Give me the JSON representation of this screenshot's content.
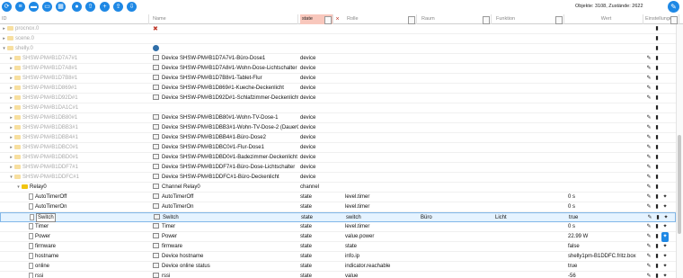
{
  "toolbar": {
    "buttons": [
      "refresh-icon",
      "list-icon",
      "folder-icon",
      "folder-open-icon",
      "table-icon",
      "user-icon",
      "upload-icon",
      "add-icon",
      "import-icon",
      "export-icon"
    ],
    "object_count": "Objekte: 3108, Zustände: 2622"
  },
  "header": {
    "id": "ID",
    "name": "Name",
    "state_filter": "state",
    "role": "Rolle",
    "room": "Raum",
    "function": "Funktion",
    "value": "Wert",
    "settings": "Einstellungen"
  },
  "colors": {
    "accent": "#1e88e5",
    "filter_active": "#f8c7bc",
    "folder": "#f1c40f",
    "selected_row": "#e5f3ff"
  },
  "rows": [
    {
      "id": "procnox.0",
      "name": "",
      "type": "",
      "role": "",
      "room": "",
      "func": "",
      "value": "",
      "icon": "procnox"
    },
    {
      "id": "scene.0",
      "name": "",
      "type": "",
      "role": "",
      "room": "",
      "func": "",
      "value": "",
      "icon": ""
    },
    {
      "id": "shelly.0",
      "name": "",
      "type": "",
      "role": "",
      "room": "",
      "func": "",
      "value": "",
      "icon": "shelly"
    },
    {
      "id": "SHSW-PM#B1D7A7#1",
      "name": "Device SHSW-PM#B1D7A7#1-Büro-Dose1",
      "type": "device",
      "role": "",
      "room": "",
      "func": "",
      "value": ""
    },
    {
      "id": "SHSW-PM#B1D7A8#1",
      "name": "Device SHSW-PM#B1D7A8#1-Wohn-Dose-Lichtschalter",
      "type": "device",
      "role": "",
      "room": "",
      "func": "",
      "value": ""
    },
    {
      "id": "SHSW-PM#B1D7B8#1",
      "name": "Device SHSW-PM#B1D7B8#1-Tablet-Flur",
      "type": "device",
      "role": "",
      "room": "",
      "func": "",
      "value": ""
    },
    {
      "id": "SHSW-PM#B1D869#1",
      "name": "Device SHSW-PM#B1D869#1-Kueche-Deckenlicht",
      "type": "device",
      "role": "",
      "room": "",
      "func": "",
      "value": ""
    },
    {
      "id": "SHSW-PM#B1D92D#1",
      "name": "Device SHSW-PM#B1D92D#1-Schlafzimmer-Deckenlicht",
      "type": "device",
      "role": "",
      "room": "",
      "func": "",
      "value": ""
    },
    {
      "id": "SHSW-PM#B1DA1C#1",
      "name": "",
      "type": "",
      "role": "",
      "room": "",
      "func": "",
      "value": ""
    },
    {
      "id": "SHSW-PM#B1DB80#1",
      "name": "Device SHSW-PM#B1DB80#1-Wohn-TV-Dose-1",
      "type": "device",
      "role": "",
      "room": "",
      "func": "",
      "value": ""
    },
    {
      "id": "SHSW-PM#B1DBB3#1",
      "name": "Device SHSW-PM#B1DBB3#1-Wohn-TV-Dose-2 (DauerON)",
      "type": "device",
      "role": "",
      "room": "",
      "func": "",
      "value": ""
    },
    {
      "id": "SHSW-PM#B1DBB4#1",
      "name": "Device SHSW-PM#B1DBB4#1-Büro-Dose2",
      "type": "device",
      "role": "",
      "room": "",
      "func": "",
      "value": ""
    },
    {
      "id": "SHSW-PM#B1DBC0#1",
      "name": "Device SHSW-PM#B1DBC0#1-Flur-Dose1",
      "type": "device",
      "role": "",
      "room": "",
      "func": "",
      "value": ""
    },
    {
      "id": "SHSW-PM#B1DBD0#1",
      "name": "Device SHSW-PM#B1DBD0#1-Badezimmer-Deckenlicht",
      "type": "device",
      "role": "",
      "room": "",
      "func": "",
      "value": ""
    },
    {
      "id": "SHSW-PM#B1DDF7#1",
      "name": "Device SHSW-PM#B1DDF7#1-Büro-Dose-Lichtschalter",
      "type": "device",
      "role": "",
      "room": "",
      "func": "",
      "value": ""
    },
    {
      "id": "SHSW-PM#B1DDFC#1",
      "name": "Device SHSW-PM#B1DDFC#1-Büro-Deckenlicht",
      "type": "device",
      "role": "",
      "room": "",
      "func": "",
      "value": ""
    },
    {
      "id": "Relay0",
      "name": "Channel Relay0",
      "type": "channel",
      "role": "",
      "room": "",
      "func": "",
      "value": ""
    },
    {
      "id": "AutoTimerOff",
      "name": "AutoTimerOff",
      "type": "state",
      "role": "level.timer",
      "room": "",
      "func": "",
      "value": "0 s"
    },
    {
      "id": "AutoTimerOn",
      "name": "AutoTimerOn",
      "type": "state",
      "role": "level.timer",
      "room": "",
      "func": "",
      "value": "0 s"
    },
    {
      "id": "Switch",
      "name": "Switch",
      "type": "state",
      "role": "switch",
      "room": "Büro",
      "func": "Licht",
      "value": "true"
    },
    {
      "id": "Timer",
      "name": "Timer",
      "type": "state",
      "role": "level.timer",
      "room": "",
      "func": "",
      "value": "0 s"
    },
    {
      "id": "Power",
      "name": "Power",
      "type": "state",
      "role": "value.power",
      "room": "",
      "func": "",
      "value": "22.99 W"
    },
    {
      "id": "firmware",
      "name": "firmware",
      "type": "state",
      "role": "state",
      "room": "",
      "func": "",
      "value": "false"
    },
    {
      "id": "hostname",
      "name": "Device hostname",
      "type": "state",
      "role": "info.ip",
      "room": "",
      "func": "",
      "value": "shelly1pm-B1DDFC.fritz.box"
    },
    {
      "id": "online",
      "name": "Device online status",
      "type": "state",
      "role": "indicator.reachable",
      "room": "",
      "func": "",
      "value": "true"
    },
    {
      "id": "rssi",
      "name": "rssi",
      "type": "state",
      "role": "value",
      "room": "",
      "func": "",
      "value": "-56"
    }
  ]
}
